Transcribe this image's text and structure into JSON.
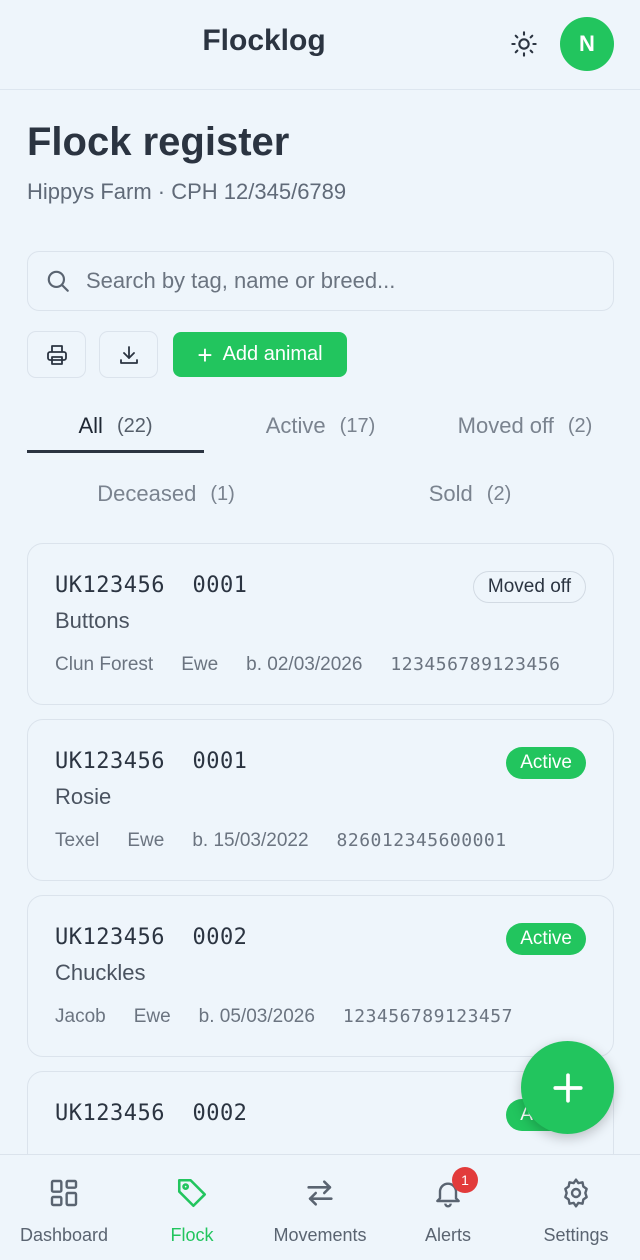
{
  "header": {
    "app_title": "Flocklog",
    "avatar_initial": "N"
  },
  "page": {
    "title": "Flock register",
    "subtitle": "Hippys Farm · CPH 12/345/6789"
  },
  "search": {
    "placeholder": "Search by tag, name or breed..."
  },
  "toolbar": {
    "add_label": "Add animal"
  },
  "tabs": [
    {
      "label": "All",
      "count": "(22)",
      "active": true
    },
    {
      "label": "Active",
      "count": "(17)"
    },
    {
      "label": "Moved off",
      "count": "(2)"
    },
    {
      "label": "Deceased",
      "count": "(1)"
    },
    {
      "label": "Sold",
      "count": "(2)"
    }
  ],
  "animals": [
    {
      "tag": "UK123456  0001",
      "name": "Buttons",
      "breed": "Clun Forest",
      "sex": "Ewe",
      "born": "b. 02/03/2026",
      "eid": "123456789123456",
      "status": "Moved off"
    },
    {
      "tag": "UK123456  0001",
      "name": "Rosie",
      "breed": "Texel",
      "sex": "Ewe",
      "born": "b. 15/03/2022",
      "eid": "826012345600001",
      "status": "Active"
    },
    {
      "tag": "UK123456  0002",
      "name": "Chuckles",
      "breed": "Jacob",
      "sex": "Ewe",
      "born": "b. 05/03/2026",
      "eid": "123456789123457",
      "status": "Active"
    },
    {
      "tag": "UK123456  0002",
      "name": "",
      "breed": "",
      "sex": "",
      "born": "",
      "eid": "",
      "status": "Active"
    }
  ],
  "bottom_nav": [
    {
      "label": "Dashboard",
      "icon": "grid-icon"
    },
    {
      "label": "Flock",
      "icon": "tag-icon",
      "active": true
    },
    {
      "label": "Movements",
      "icon": "arrows-icon"
    },
    {
      "label": "Alerts",
      "icon": "bell-icon",
      "badge": "1"
    },
    {
      "label": "Settings",
      "icon": "gear-icon"
    }
  ],
  "colors": {
    "accent": "#22c55e",
    "background": "#eef5fb",
    "alert": "#e23b3b"
  }
}
